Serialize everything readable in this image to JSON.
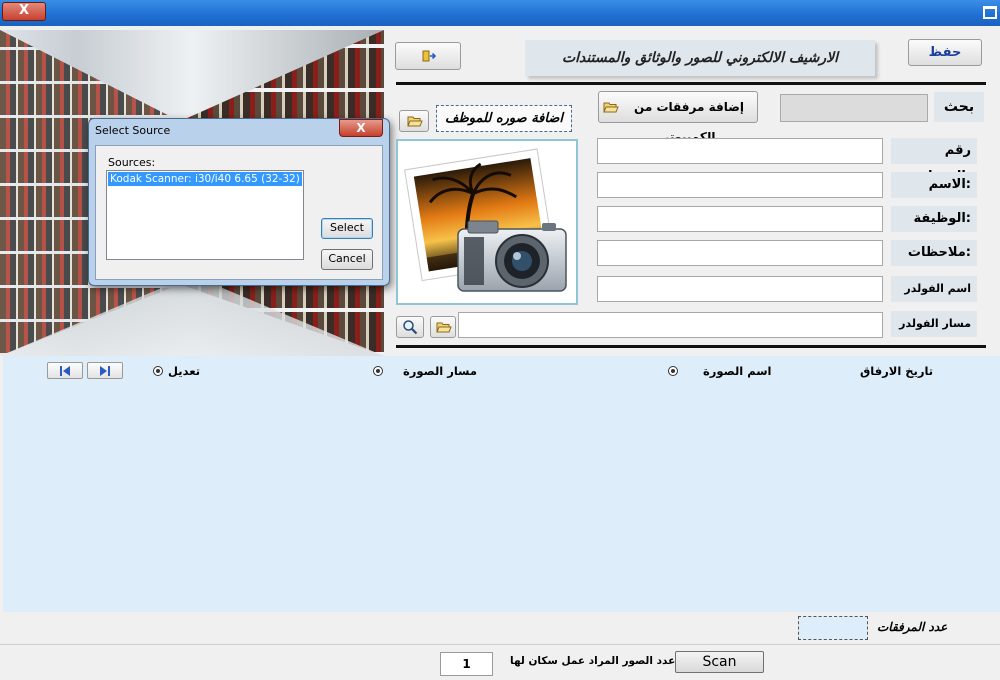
{
  "window": {
    "close_label": "X"
  },
  "dialog": {
    "title": "Select Source",
    "close_label": "X",
    "sources_label": "Sources:",
    "sources": [
      "Kodak Scanner: i30/i40 6.65 (32-32)"
    ],
    "select_label": "Select",
    "cancel_label": "Cancel"
  },
  "header": {
    "banner_title": "الارشيف الالكتروني للصور والوثائق والمستندات",
    "save_label": "حفظ"
  },
  "search": {
    "label": "بحث"
  },
  "actions": {
    "add_attachments_label": "إضافة مرفقات من الكمبيوتر",
    "add_photo_label": "اضافة صوره للموظف"
  },
  "form": {
    "employee_number_label": "رقم الموظف:",
    "name_label": "الاسم:",
    "job_label": "الوظيفة:",
    "notes_label": "ملاحظات:",
    "folder_name_label": "اسم الفولدر",
    "folder_path_label": "مسار الفولدر"
  },
  "grid": {
    "columns": {
      "date": "تاريخ الارفاق",
      "image_name": "اسم الصورة",
      "image_path": "مسار الصورة",
      "edit": "تعديل"
    }
  },
  "footer": {
    "attachments_count_label": "عدد المرفقات",
    "scan_label": "Scan",
    "scan_count_label": "عدد الصور المراد عمل سكان لها",
    "scan_count_value": "1"
  },
  "colors": {
    "titlebar": "#1f6fd1",
    "grid_background": "#ddeefa",
    "label_background": "#dfe6ec",
    "selection": "#3399ff"
  }
}
